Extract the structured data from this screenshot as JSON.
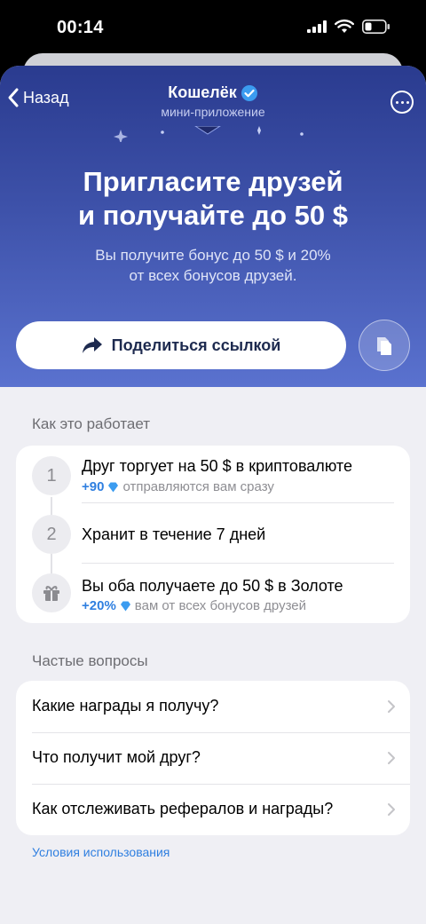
{
  "status_bar": {
    "time": "00:14",
    "icons": [
      "cellular-icon",
      "wifi-icon",
      "battery-icon"
    ]
  },
  "nav": {
    "back_label": "Назад",
    "title": "Кошелёк",
    "subtitle": "мини-приложение",
    "verified_icon": "verified-badge-icon",
    "more_icon": "more-icon"
  },
  "hero": {
    "title_line1": "Пригласите друзей",
    "title_line2": "и получайте до 50 $",
    "subtitle_line1": "Вы получите бонус до 50 $ и 20%",
    "subtitle_line2": "от всех бонусов друзей.",
    "share_label": "Поделиться ссылкой",
    "share_icon": "share-arrow-icon",
    "copy_icon": "copy-icon"
  },
  "how_it_works": {
    "title": "Как это работает",
    "steps": [
      {
        "badge": "1",
        "title": "Друг торгует на 50 $ в криптовалюте",
        "note_amount": "+90",
        "note_text": "отправляются вам сразу"
      },
      {
        "badge": "2",
        "title": "Хранит в течение 7 дней"
      },
      {
        "badge_icon": "gift-icon",
        "title": "Вы оба получаете до 50 $ в Золоте",
        "note_amount": "+20%",
        "note_text": "вам от всех бонусов друзей"
      }
    ]
  },
  "faq": {
    "title": "Частые вопросы",
    "items": [
      {
        "label": "Какие награды я получу?"
      },
      {
        "label": "Что получит мой друг?"
      },
      {
        "label": "Как отслеживать рефералов и награды?"
      }
    ]
  },
  "terms_link": "Условия использования",
  "colors": {
    "hero_top": "#2a3b8f",
    "hero_bottom": "#5a72cf",
    "accent_blue": "#2f7fe0",
    "background": "#efeff4"
  }
}
